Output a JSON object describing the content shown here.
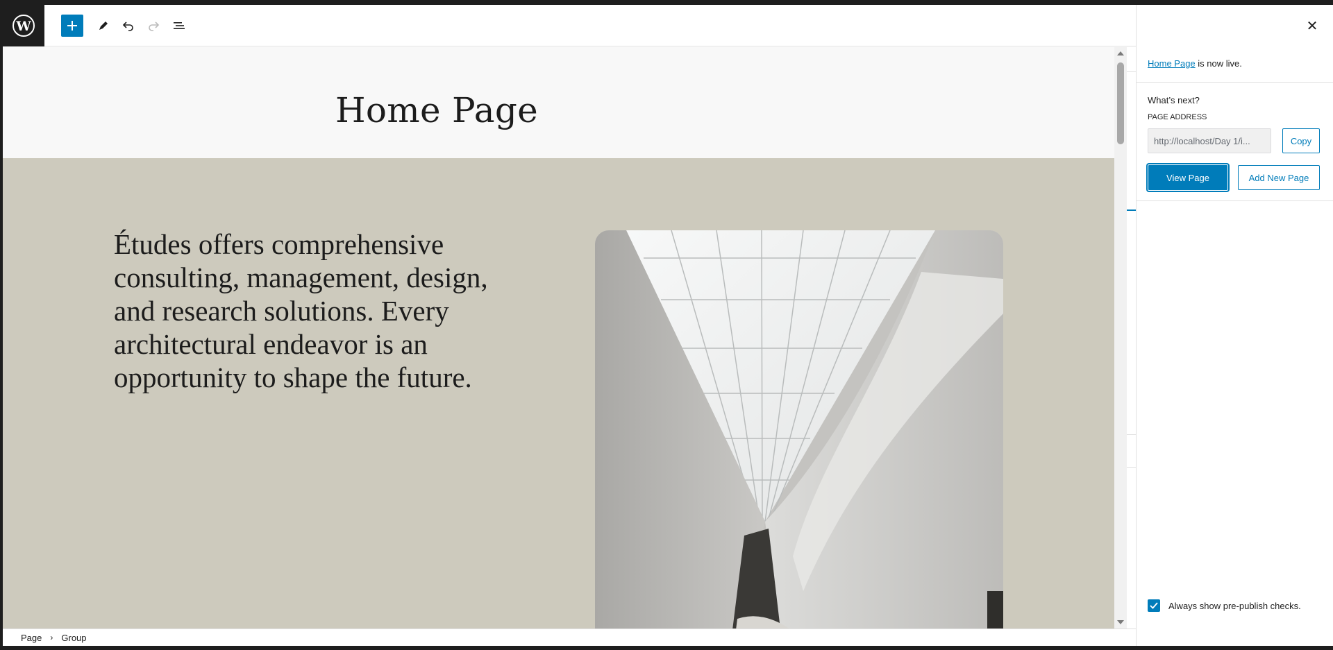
{
  "toolbar": {
    "icons": {
      "logo": "wordpress-logo-icon",
      "add": "plus-icon",
      "tools": "pencil-icon",
      "undo": "undo-icon",
      "redo": "redo-icon",
      "outline": "list-view-icon"
    }
  },
  "canvas": {
    "page_title": "Home Page",
    "intro_text": "Études offers comprehensive consulting, management, design, and research solutions. Every architectural endeavor is an opportunity to shape the future.",
    "group_background": "#cdcabd"
  },
  "breadcrumb": {
    "items": [
      "Page",
      "Group"
    ]
  },
  "panel": {
    "live_link": "Home Page",
    "live_suffix": " is now live.",
    "whats_next": "What’s next?",
    "page_address_label": "PAGE ADDRESS",
    "page_address_value": "http://localhost/Day 1/i...",
    "copy_label": "Copy",
    "view_page_label": "View Page",
    "add_new_page_label": "Add New Page",
    "prepublish_label": "Always show pre-publish checks.",
    "prepublish_checked": true
  },
  "colors": {
    "accent": "#007cba",
    "toolbar_logo_bg": "#1e1e1e"
  }
}
